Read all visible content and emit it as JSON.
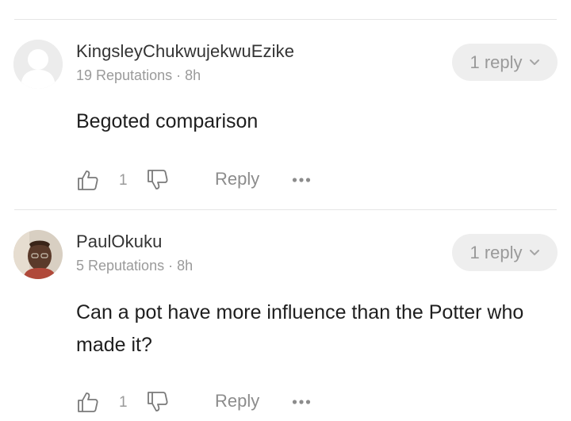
{
  "comments": [
    {
      "username": "KingsleyChukwujekwuEzike",
      "meta": "19 Reputations · 8h",
      "replies_label": "1 reply",
      "text": "Begoted comparison",
      "likes": "1",
      "reply_label": "Reply",
      "avatar": "default-avatar"
    },
    {
      "username": "PaulOkuku",
      "meta": "5 Reputations · 8h",
      "replies_label": "1 reply",
      "text": "Can a pot have more influence than the Potter who made it?",
      "likes": "1",
      "reply_label": "Reply",
      "avatar": "photo-avatar"
    }
  ],
  "icons": {
    "like": "thumbs-up-icon",
    "dislike": "thumbs-down-icon",
    "more": "more-options-icon",
    "expand": "chevron-down-icon"
  },
  "colors": {
    "muted_text": "#9a9a9a",
    "pill_background": "#eeeeee",
    "divider": "#e6e6e6"
  }
}
